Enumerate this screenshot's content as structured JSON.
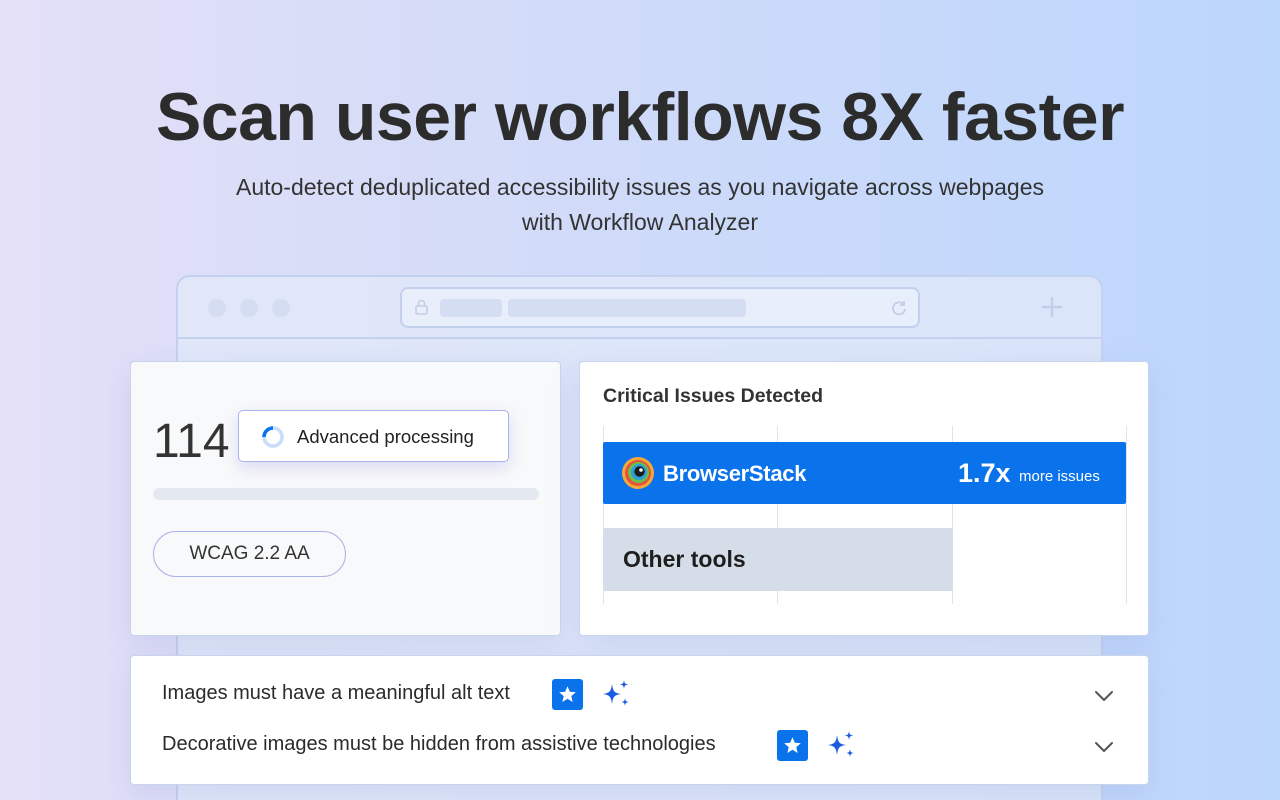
{
  "hero": {
    "title": "Scan user workflows 8X faster",
    "subtitle_line1": "Auto-detect deduplicated accessibility issues as you navigate across webpages",
    "subtitle_line2": "with Workflow Analyzer"
  },
  "browser": {
    "icons": [
      "lock-icon",
      "reload-icon",
      "plus-icon"
    ]
  },
  "scan_card": {
    "issue_count": "114",
    "status_label": "Advanced processing",
    "standard_badge": "WCAG 2.2 AA"
  },
  "comparison_card": {
    "title": "Critical Issues Detected",
    "browserstack": {
      "name": "BrowserStack",
      "multiplier": "1.7x",
      "suffix": "more issues",
      "color": "#0a72ea"
    },
    "other": {
      "name": "Other tools",
      "color": "#d5dee8"
    }
  },
  "issues_list": [
    {
      "text": "Images must have a meaningful alt text",
      "icons": [
        "star-icon",
        "sparkle-icon",
        "chevron-down-icon"
      ]
    },
    {
      "text": "Decorative images must be hidden from assistive technologies",
      "icons": [
        "star-icon",
        "sparkle-icon",
        "chevron-down-icon"
      ]
    }
  ],
  "colors": {
    "accent": "#0a72ea",
    "text": "#2c2c2c"
  }
}
